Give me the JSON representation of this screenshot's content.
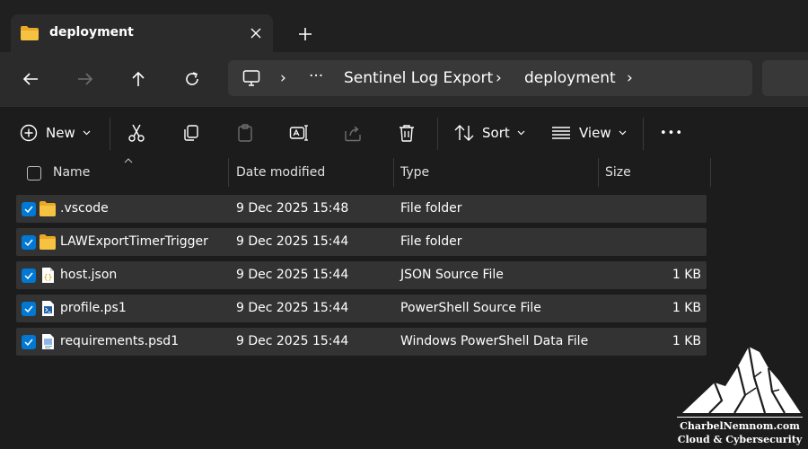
{
  "tab": {
    "title": "deployment",
    "folder_icon": "folder-icon",
    "close_icon": "close-icon",
    "new_tab_icon": "plus-icon"
  },
  "nav": {
    "back_icon": "arrow-left-icon",
    "forward_icon": "arrow-right-icon",
    "up_icon": "arrow-up-icon",
    "refresh_icon": "refresh-icon"
  },
  "address": {
    "monitor_icon": "monitor-icon",
    "overflow": "···",
    "crumbs": [
      "Sentinel Log Export",
      "deployment"
    ],
    "separator": "›"
  },
  "commands": {
    "new_label": "New",
    "sort_label": "Sort",
    "view_label": "View",
    "more_label": "•••"
  },
  "columns": {
    "name": "Name",
    "date_modified": "Date modified",
    "type": "Type",
    "size": "Size"
  },
  "files": [
    {
      "name": ".vscode",
      "date": "9 Dec 2025 15:48",
      "type": "File folder",
      "size": "",
      "icon": "folder-icon"
    },
    {
      "name": "LAWExportTimerTrigger",
      "date": "9 Dec 2025 15:44",
      "type": "File folder",
      "size": "",
      "icon": "folder-icon"
    },
    {
      "name": "host.json",
      "date": "9 Dec 2025 15:44",
      "type": "JSON Source File",
      "size": "1 KB",
      "icon": "json-file-icon"
    },
    {
      "name": "profile.ps1",
      "date": "9 Dec 2025 15:44",
      "type": "PowerShell Source File",
      "size": "1 KB",
      "icon": "powershell-file-icon"
    },
    {
      "name": "requirements.psd1",
      "date": "9 Dec 2025 15:44",
      "type": "Windows PowerShell Data File",
      "size": "1 KB",
      "icon": "powershell-data-file-icon"
    }
  ],
  "watermark": {
    "line1": "CharbelNemnom.com",
    "line2": "Cloud & Cybersecurity"
  },
  "colors": {
    "accent": "#0078d4",
    "folder": "#f5c242",
    "background": "#1c1c1c",
    "row": "#333333"
  }
}
